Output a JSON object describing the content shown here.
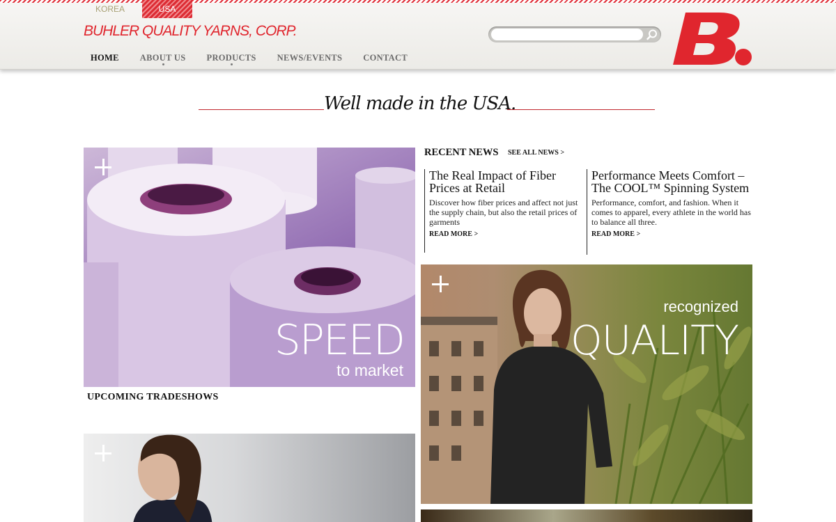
{
  "header": {
    "regions": [
      {
        "label": "KOREA",
        "active": false
      },
      {
        "label": "USA",
        "active": true
      }
    ],
    "company_name": "BUHLER QUALITY YARNS, CORP.",
    "nav": [
      {
        "label": "HOME",
        "active": true,
        "has_submenu": false
      },
      {
        "label": "ABOUT US",
        "active": false,
        "has_submenu": true
      },
      {
        "label": "PRODUCTS",
        "active": false,
        "has_submenu": true
      },
      {
        "label": "NEWS/EVENTS",
        "active": false,
        "has_submenu": false
      },
      {
        "label": "CONTACT",
        "active": false,
        "has_submenu": false
      }
    ],
    "search": {
      "value": "",
      "placeholder": ""
    },
    "logo_text": "B.",
    "brand_color": "#e0262e"
  },
  "tagline": "Well made in the USA.",
  "tiles": {
    "speed": {
      "word": "SPEED",
      "sub": "to market",
      "icon": "plus-icon"
    },
    "quality": {
      "small": "recognized",
      "word": "QUALITY",
      "icon": "plus-icon"
    },
    "model2": {
      "icon": "plus-icon"
    }
  },
  "sections": {
    "upcoming_tradeshows": "UPCOMING TRADESHOWS"
  },
  "news": {
    "heading": "RECENT NEWS",
    "see_all": "SEE ALL NEWS >",
    "items": [
      {
        "title": "The Real Impact of Fiber Prices at Retail",
        "excerpt": "Discover how fiber prices and affect not just the supply chain, but also the retail prices of garments",
        "read_more": "READ MORE >"
      },
      {
        "title": "Performance Meets Comfort – The COOL™ Spinning System",
        "excerpt": "Performance, comfort, and fashion. When it comes to apparel, every athlete in the world has to balance all three.",
        "read_more": "READ MORE >"
      }
    ]
  }
}
